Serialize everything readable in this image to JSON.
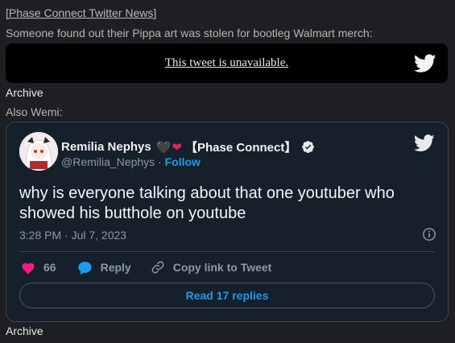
{
  "header": {
    "link_text": "[Phase Connect Twitter News]"
  },
  "post": {
    "line1": "Someone found out their Pippa art was stolen for bootleg Walmart merch:",
    "unavailable_text": "This tweet is unavailable.",
    "archive1": "Archive",
    "also_text": "Also Wemi:",
    "archive2": "Archive"
  },
  "tweet": {
    "display_name": "Remilia Nephys",
    "name_tag": "【Phase Connect】",
    "handle": "@Remilia_Nephys",
    "separator": " · ",
    "follow_label": "Follow",
    "text": "why is everyone talking about that one youtuber who showed his butthole on youtube",
    "timestamp": "3:28 PM · Jul 7, 2023",
    "like_count": "66",
    "reply_label": "Reply",
    "copy_link_label": "Copy link to Tweet",
    "read_replies_label": "Read 17 replies"
  },
  "icons": {
    "twitter_bird": "twitter-bird-icon",
    "verified": "verified-badge-icon",
    "info": "info-icon",
    "like": "heart-icon",
    "reply": "reply-bubble-icon",
    "copy_link": "link-icon"
  },
  "colors": {
    "background": "#1e1f22",
    "card_bg": "#15202b",
    "accent": "#1d9bf0",
    "like": "#f91880"
  }
}
